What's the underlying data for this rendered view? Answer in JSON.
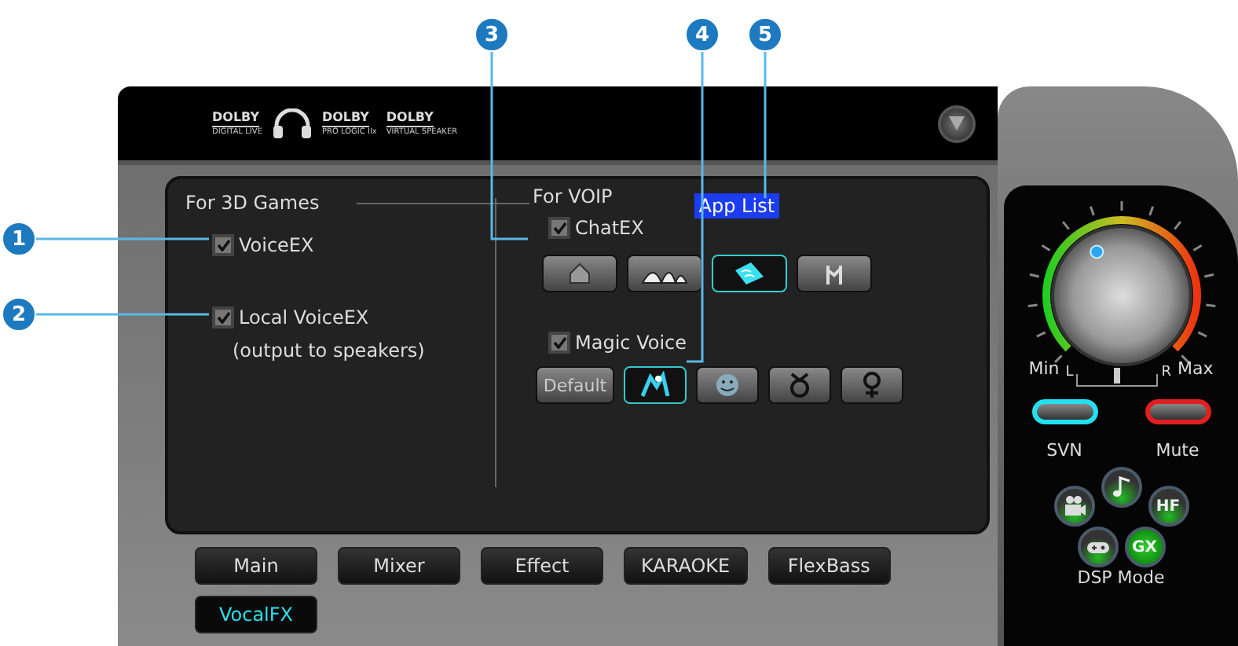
{
  "callouts": [
    {
      "number": "1"
    },
    {
      "number": "2"
    },
    {
      "number": "3"
    },
    {
      "number": "4"
    },
    {
      "number": "5"
    }
  ],
  "header": {
    "logos": [
      {
        "kind": "dolby",
        "brand": "DOLBY",
        "subtitle": "DIGITAL LIVE"
      },
      {
        "kind": "headphone"
      },
      {
        "kind": "dolby",
        "brand": "DOLBY",
        "subtitle": "PRO LOGIC IIx"
      },
      {
        "kind": "dolby",
        "brand": "DOLBY",
        "subtitle": "VIRTUAL SPEAKER"
      }
    ]
  },
  "games": {
    "title": "For 3D Games",
    "options": [
      {
        "label": "VoiceEX",
        "checked": true
      },
      {
        "label": "Local VoiceEX",
        "note": "(output to speakers)",
        "checked": true
      }
    ]
  },
  "voip": {
    "title": "For VOIP",
    "app_list": "App List",
    "chatex": {
      "label": "ChatEX",
      "checked": true
    },
    "environments": [
      {
        "kind": "room",
        "selected": false
      },
      {
        "kind": "hall",
        "selected": false
      },
      {
        "kind": "water",
        "selected": true
      },
      {
        "kind": "forest",
        "selected": false
      }
    ],
    "magic_voice": {
      "label": "Magic Voice",
      "checked": true
    },
    "voices": [
      {
        "kind": "default",
        "label": "Default",
        "selected": false
      },
      {
        "kind": "monster",
        "selected": true
      },
      {
        "kind": "cartoon",
        "selected": false
      },
      {
        "kind": "male",
        "selected": false
      },
      {
        "kind": "female",
        "selected": false
      }
    ]
  },
  "tabs": [
    {
      "label": "Main",
      "selected": false
    },
    {
      "label": "Mixer",
      "selected": false
    },
    {
      "label": "Effect",
      "selected": false
    },
    {
      "label": "KARAOKE",
      "selected": false
    },
    {
      "label": "FlexBass",
      "selected": false
    },
    {
      "label": "VocalFX",
      "selected": true
    }
  ],
  "volume": {
    "level": 0.39,
    "min": "Min",
    "max": "Max"
  },
  "balance": {
    "left": "L",
    "right": "R",
    "level": 0.5
  },
  "switches": [
    {
      "label": "SVN",
      "color": "#22e0f0"
    },
    {
      "label": "Mute",
      "color": "#e02020"
    }
  ],
  "dsp": {
    "label": "DSP Mode",
    "modes": [
      {
        "kind": "movie",
        "selected": false
      },
      {
        "kind": "music",
        "selected": false
      },
      {
        "kind": "hifi",
        "text": "HF",
        "selected": false
      },
      {
        "kind": "game",
        "selected": false
      },
      {
        "kind": "gx",
        "text": "GX",
        "selected": true
      }
    ]
  }
}
